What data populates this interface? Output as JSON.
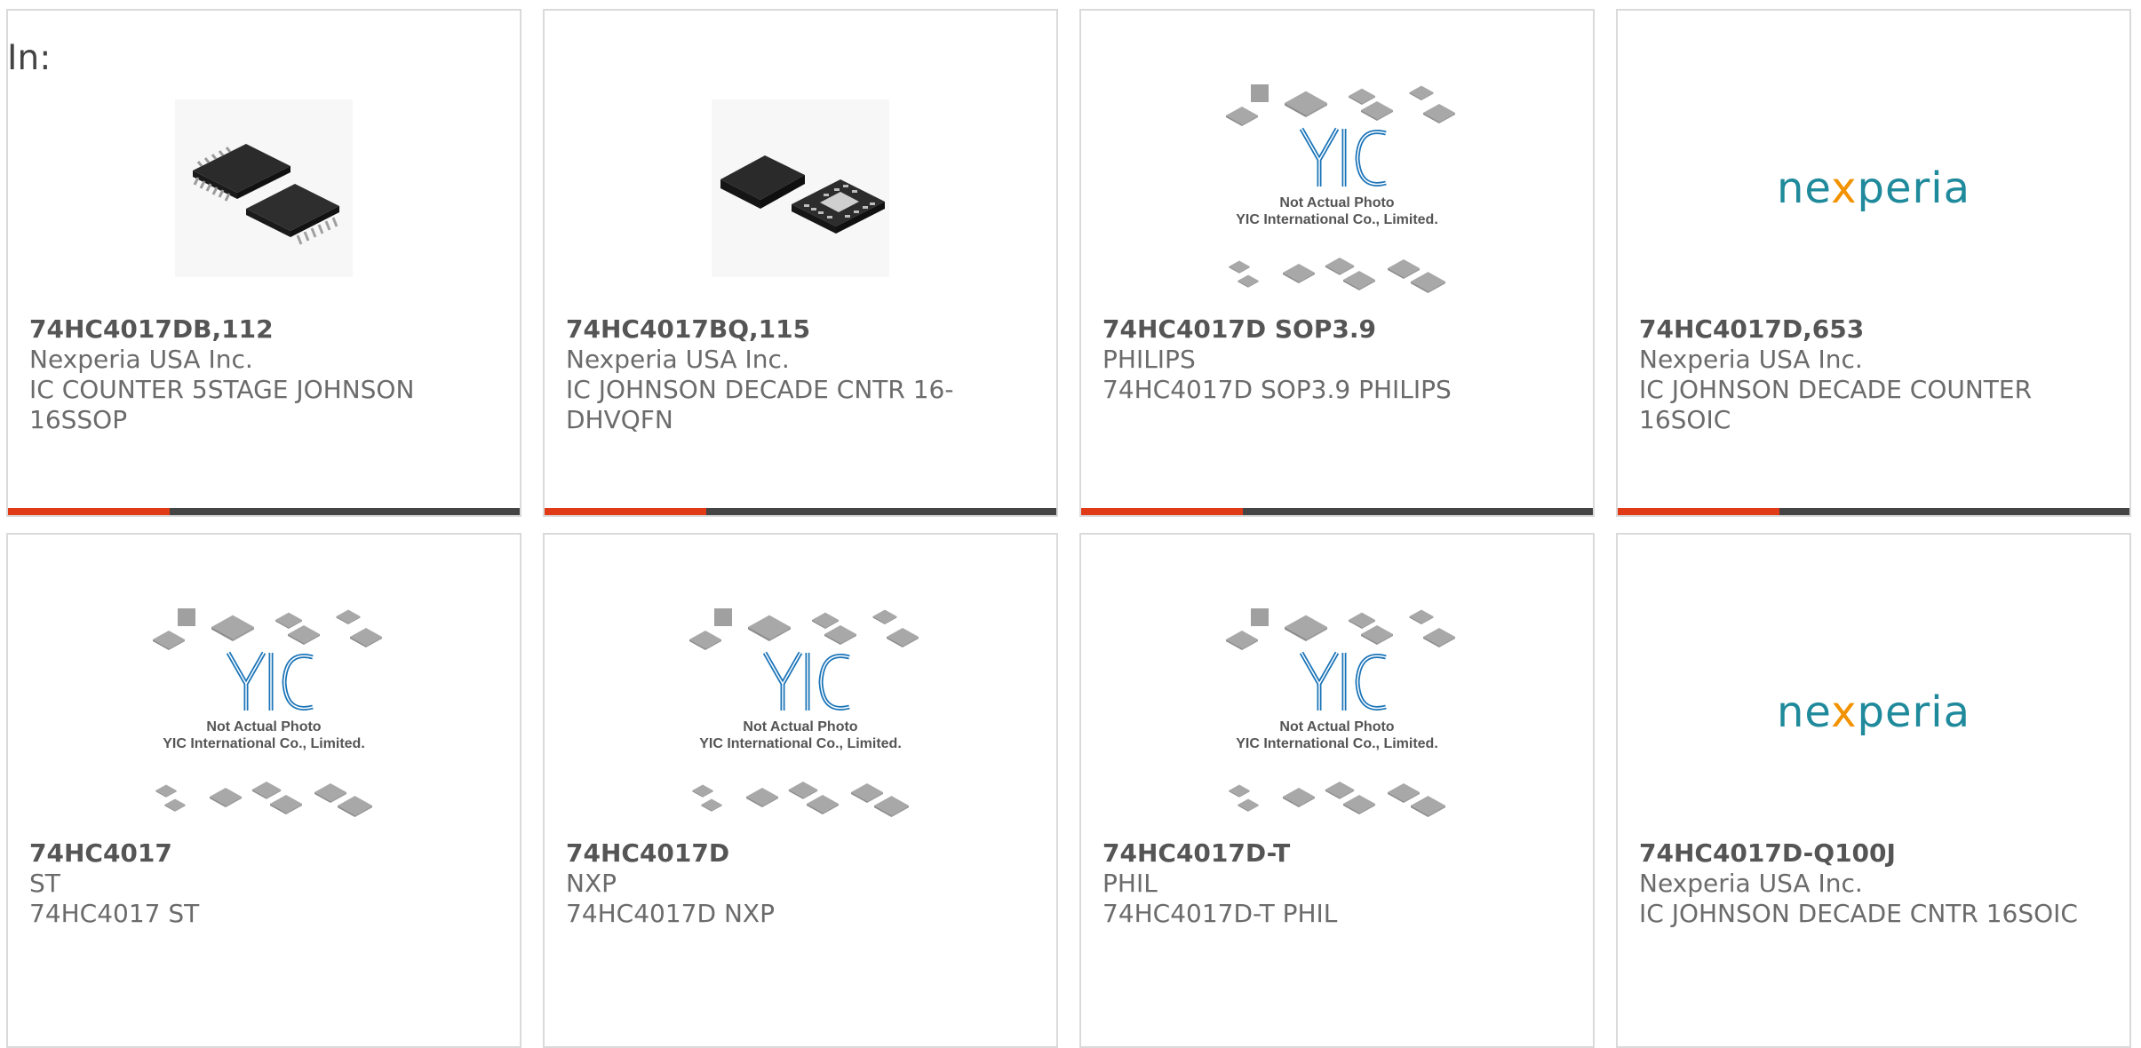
{
  "header": {
    "in_label": "In:"
  },
  "brand_colors": {
    "accent": "#e03b16",
    "bar": "#444444",
    "yic_blue": "#1a74b8",
    "nexperia_teal": "#1f8a9b",
    "nexperia_orange": "#f39200"
  },
  "placeholder": {
    "line1": "Not Actual Photo",
    "line2": "YIC International Co., Limited.",
    "logo": "YIC"
  },
  "nexperia_logo": {
    "pre": "ne",
    "x": "x",
    "post": "peria"
  },
  "products": [
    {
      "part": "74HC4017DB,112",
      "manufacturer": "Nexperia USA Inc.",
      "description": "IC COUNTER 5STAGE JOHNSON 16SSOP",
      "image": "ssop-chip-photo"
    },
    {
      "part": "74HC4017BQ,115",
      "manufacturer": "Nexperia USA Inc.",
      "description": "IC JOHNSON DECADE CNTR 16-DHVQFN",
      "image": "qfn-chip-photo"
    },
    {
      "part": "74HC4017D SOP3.9",
      "manufacturer": "PHILIPS",
      "description": "74HC4017D SOP3.9 PHILIPS",
      "image": "yic-placeholder"
    },
    {
      "part": "74HC4017D,653",
      "manufacturer": "Nexperia USA Inc.",
      "description": "IC JOHNSON DECADE COUNTER 16SOIC",
      "image": "nexperia-logo"
    },
    {
      "part": "74HC4017",
      "manufacturer": "ST",
      "description": "74HC4017 ST",
      "image": "yic-placeholder"
    },
    {
      "part": "74HC4017D",
      "manufacturer": "NXP",
      "description": "74HC4017D NXP",
      "image": "yic-placeholder"
    },
    {
      "part": "74HC4017D-T",
      "manufacturer": "PHIL",
      "description": "74HC4017D-T PHIL",
      "image": "yic-placeholder"
    },
    {
      "part": "74HC4017D-Q100J",
      "manufacturer": "Nexperia USA Inc.",
      "description": "IC JOHNSON DECADE CNTR 16SOIC",
      "image": "nexperia-logo"
    }
  ]
}
